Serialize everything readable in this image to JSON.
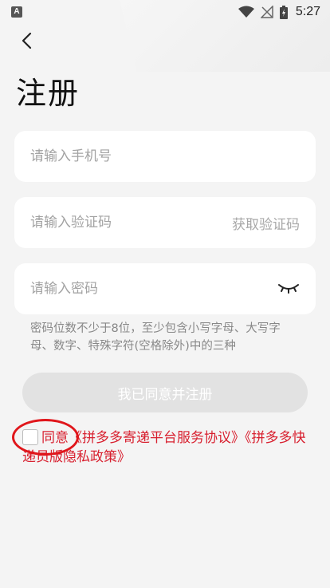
{
  "status_bar": {
    "notification_badge": "A",
    "time": "5:27",
    "icons": [
      "wifi-icon",
      "signal-icon",
      "battery-icon"
    ]
  },
  "page": {
    "title": "注册",
    "back_icon": "chevron-left-icon"
  },
  "form": {
    "phone_placeholder": "请输入手机号",
    "code_placeholder": "请输入验证码",
    "get_code_label": "获取验证码",
    "password_placeholder": "请输入密码",
    "password_hint": "密码位数不少于8位，至少包含小写字母、大写字母、数字、特殊字符(空格除外)中的三种",
    "submit_label": "我已同意并注册"
  },
  "agreement": {
    "prefix": "同意",
    "link1": "《拼多多寄递平台服务协议》",
    "link2": "《拼多多快递员版隐私政策》",
    "checked": false
  },
  "colors": {
    "accent_red": "#d8202f",
    "button_disabled": "#e2e2e2",
    "background": "#f4f4f4"
  }
}
